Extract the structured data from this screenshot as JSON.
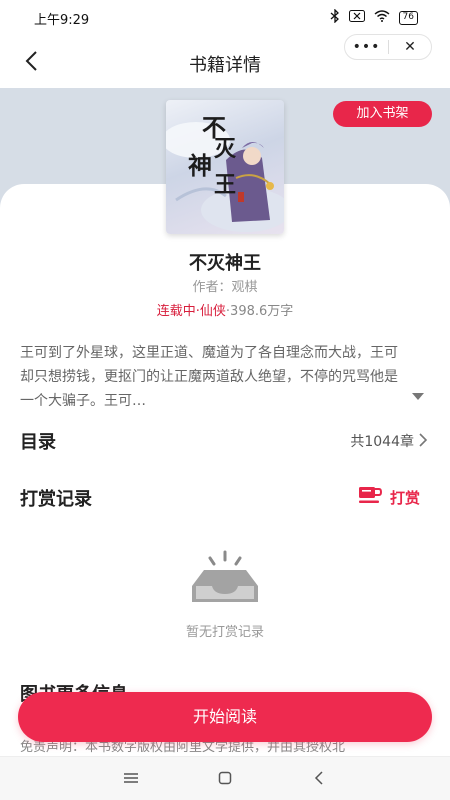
{
  "status_bar": {
    "time": "上午9:29",
    "battery": "76"
  },
  "nav": {
    "title": "书籍详情",
    "more_label": "•••",
    "close_label": "✕"
  },
  "book": {
    "add_to_shelf": "加入书架",
    "title": "不灭神王",
    "author": "作者：观棋",
    "status": "连载中",
    "genre": "仙侠",
    "word_count": "398.6万字",
    "cover_title": "不灭神王",
    "description": "王可到了外星球，这里正道、魔道为了各自理念而大战，王可却只想捞钱，更抠门的让正魔两道敌人绝望，不停的咒骂他是一个大骗子。王可…"
  },
  "catalog": {
    "label": "目录",
    "count": "共1044章"
  },
  "reward": {
    "label": "打赏记录",
    "button_label": "打赏",
    "empty_text": "暂无打赏记录"
  },
  "more_info": {
    "label": "图书更多信息",
    "disclaimer": "免责声明：本书数字版权由阿里文学提供，并由其授权北"
  },
  "read_button": "开始阅读",
  "colors": {
    "accent": "#e8264a",
    "hero_bg": "#d6dde6"
  }
}
